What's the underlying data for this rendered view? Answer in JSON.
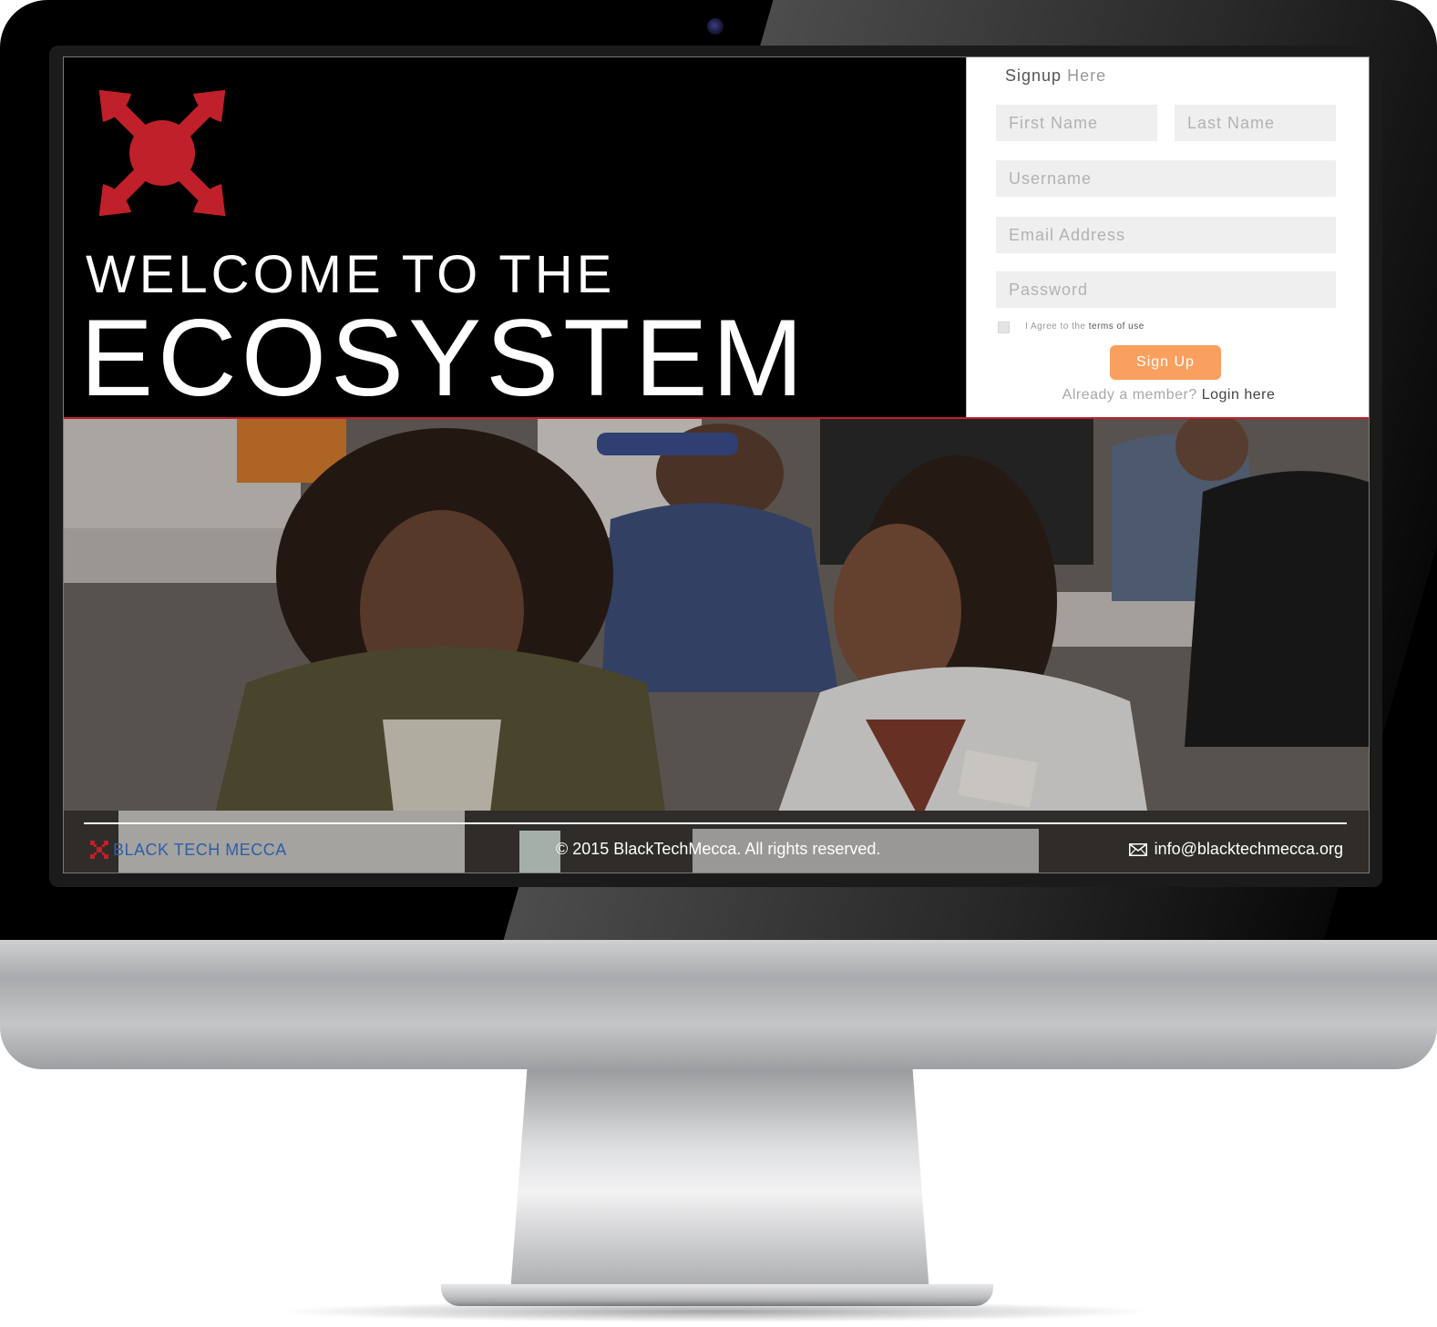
{
  "hero": {
    "welcome": "WELCOME TO THE",
    "title": "ECOSYSTEM"
  },
  "signup": {
    "title_part1": "Signup",
    "title_part2": " Here",
    "first_name_placeholder": "First Name",
    "last_name_placeholder": "Last Name",
    "username_placeholder": "Username",
    "email_placeholder": "Email Address",
    "password_placeholder": "Password",
    "agree_text": "I Agree to the ",
    "terms_link": "terms of use",
    "signup_button": "Sign Up",
    "member_text": "Already a member? ",
    "login_link": "Login here"
  },
  "footer": {
    "logo_text": "BLACK TECH MECCA",
    "copyright": "© 2015 BlackTechMecca. All rights reserved.",
    "email": "info@blacktechmecca.org"
  },
  "colors": {
    "brand_red": "#c0202a",
    "signup_button": "#f9a05f",
    "footer_logo_blue": "#2f5ea8"
  },
  "icons": [
    "logo-x-icon",
    "mail-icon"
  ]
}
